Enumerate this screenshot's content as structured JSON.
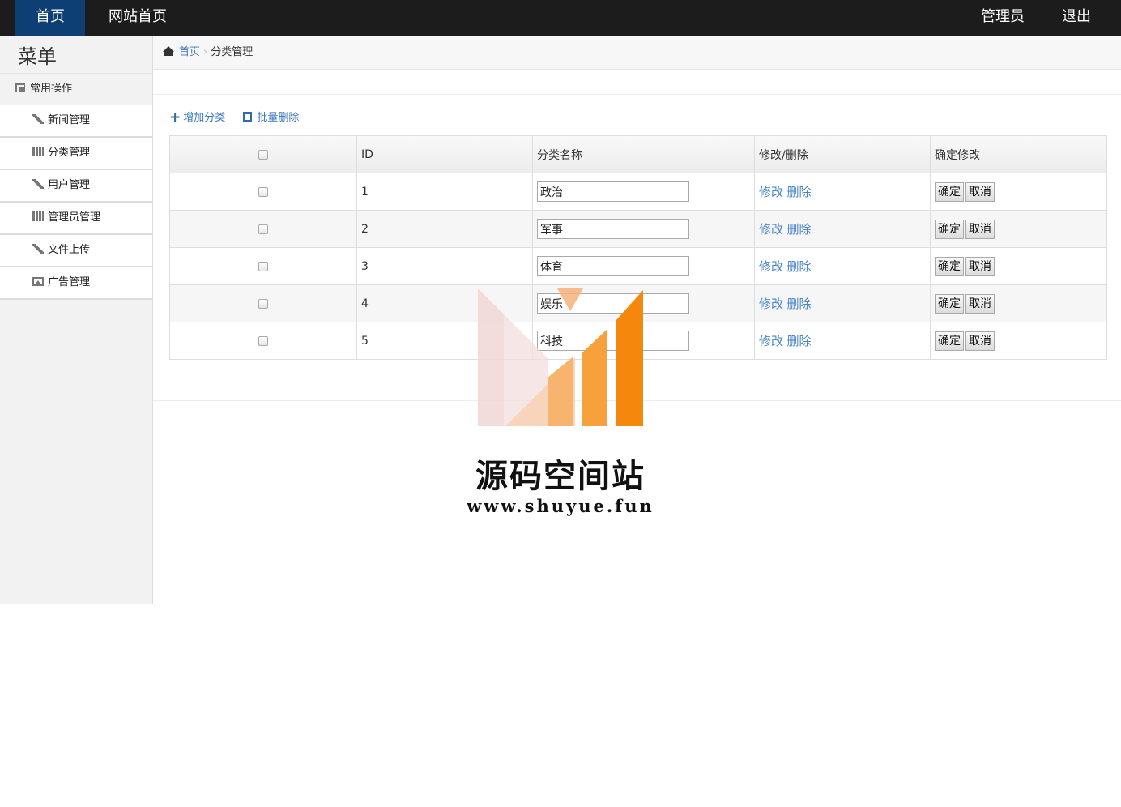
{
  "topbar": {
    "home": "首页",
    "site_home": "网站首页",
    "admin": "管理员",
    "logout": "退出",
    "active_color": "#0e3f74"
  },
  "sidebar": {
    "title": "菜单",
    "group": "常用操作",
    "items": [
      {
        "label": "新闻管理",
        "icon": "wrench-icon"
      },
      {
        "label": "分类管理",
        "icon": "books-icon"
      },
      {
        "label": "用户管理",
        "icon": "wrench-icon"
      },
      {
        "label": "管理员管理",
        "icon": "books-icon"
      },
      {
        "label": "文件上传",
        "icon": "wrench-icon"
      },
      {
        "label": "广告管理",
        "icon": "picture-icon"
      }
    ]
  },
  "breadcrumb": {
    "home": "首页",
    "current": "分类管理"
  },
  "toolbar": {
    "add": "增加分类",
    "batch_delete": "批量删除"
  },
  "table": {
    "headers": {
      "id": "ID",
      "name": "分类名称",
      "edit": "修改/删除",
      "confirm": "确定修改"
    },
    "rows": [
      {
        "id": "1",
        "name": "政治"
      },
      {
        "id": "2",
        "name": "军事"
      },
      {
        "id": "3",
        "name": "体育"
      },
      {
        "id": "4",
        "name": "娱乐"
      },
      {
        "id": "5",
        "name": "科技"
      }
    ],
    "edit_label": "修改",
    "delete_label": "删除",
    "ok_label": "确定",
    "cancel_label": "取消"
  },
  "watermark": {
    "title": "源码空间站",
    "url": "www.shuyue.fun"
  }
}
